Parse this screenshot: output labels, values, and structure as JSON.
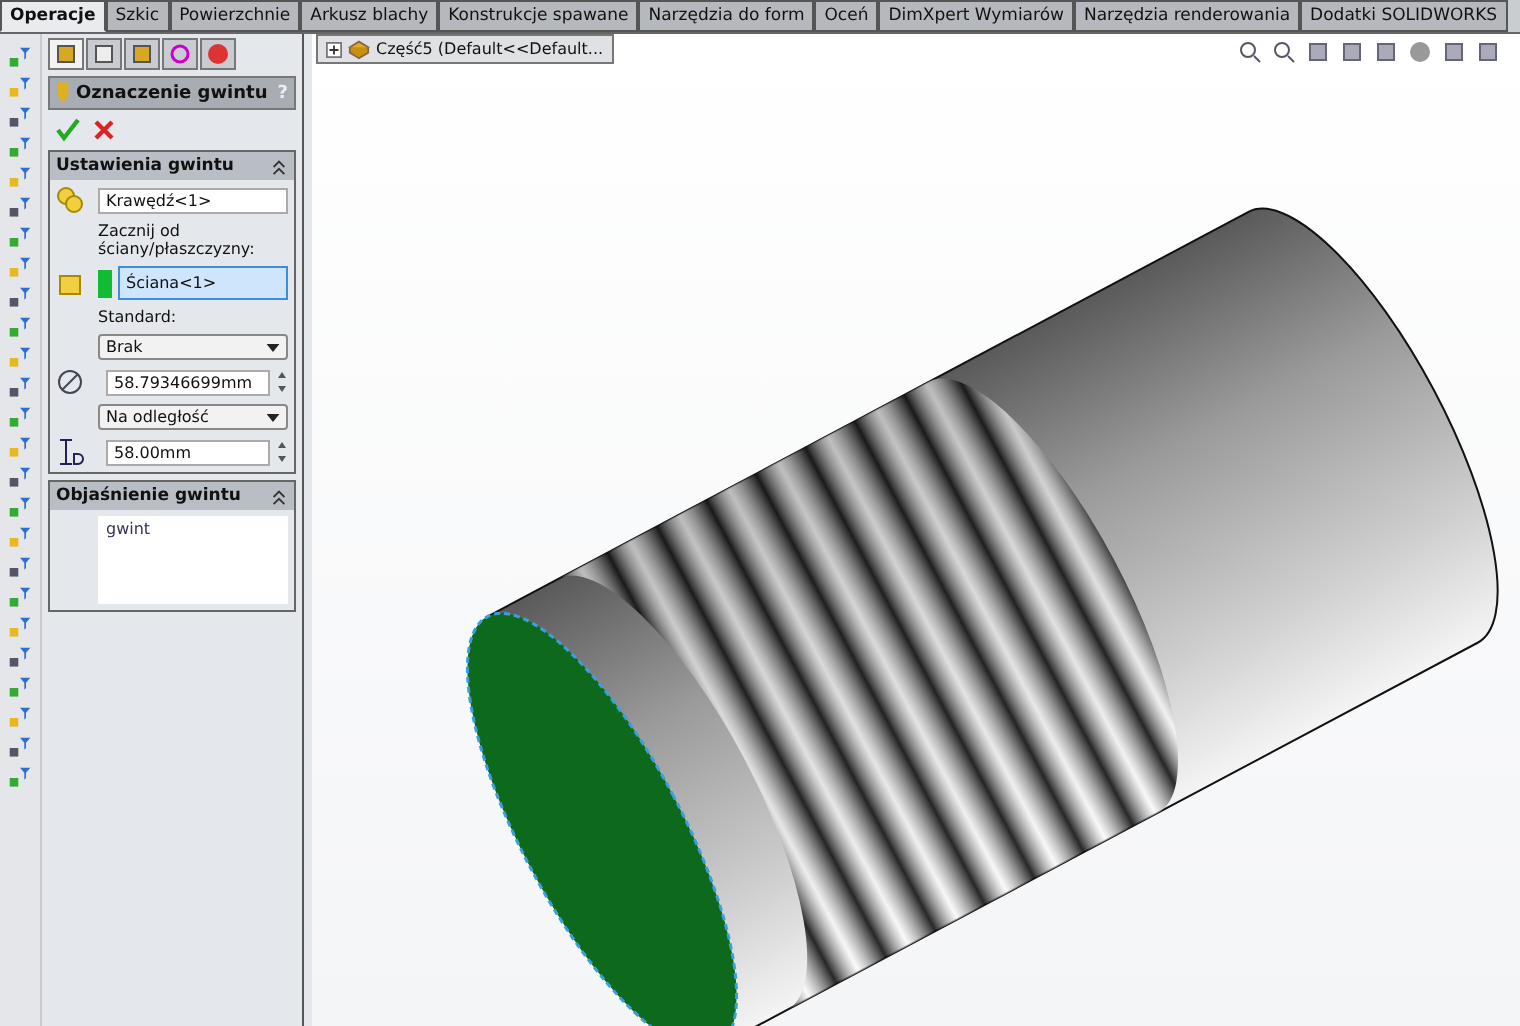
{
  "command_tabs": [
    {
      "label": "Operacje",
      "selected": true
    },
    {
      "label": "Szkic",
      "selected": false
    },
    {
      "label": "Powierzchnie",
      "selected": false
    },
    {
      "label": "Arkusz blachy",
      "selected": false
    },
    {
      "label": "Konstrukcje spawane",
      "selected": false
    },
    {
      "label": "Narzędzia do form",
      "selected": false
    },
    {
      "label": "Oceń",
      "selected": false
    },
    {
      "label": "DimXpert Wymiarów",
      "selected": false
    },
    {
      "label": "Narzędzia renderowania",
      "selected": false
    },
    {
      "label": "Dodatki SOLIDWORKS",
      "selected": false
    }
  ],
  "panel_tabs": [
    {
      "selected": true
    },
    {
      "selected": false
    },
    {
      "selected": false
    },
    {
      "selected": false
    },
    {
      "selected": false
    }
  ],
  "property_manager": {
    "title": "Oznaczenie gwintu",
    "help": "?",
    "settings": {
      "title": "Ustawienia gwintu",
      "expanded": true,
      "edge": "Krawędź<1>",
      "start_label": "Zacznij od ściany/płaszczyzny:",
      "start_face": "Ściana<1>",
      "standard_label": "Standard:",
      "standard": "Brak",
      "diameter": "58.79346699mm",
      "end_condition": "Na odległość",
      "depth": "58.00mm"
    },
    "callout": {
      "title": "Objaśnienie gwintu",
      "expanded": true,
      "text": "gwint"
    }
  },
  "tree": {
    "item": "Część5  (Default<<Default..."
  }
}
